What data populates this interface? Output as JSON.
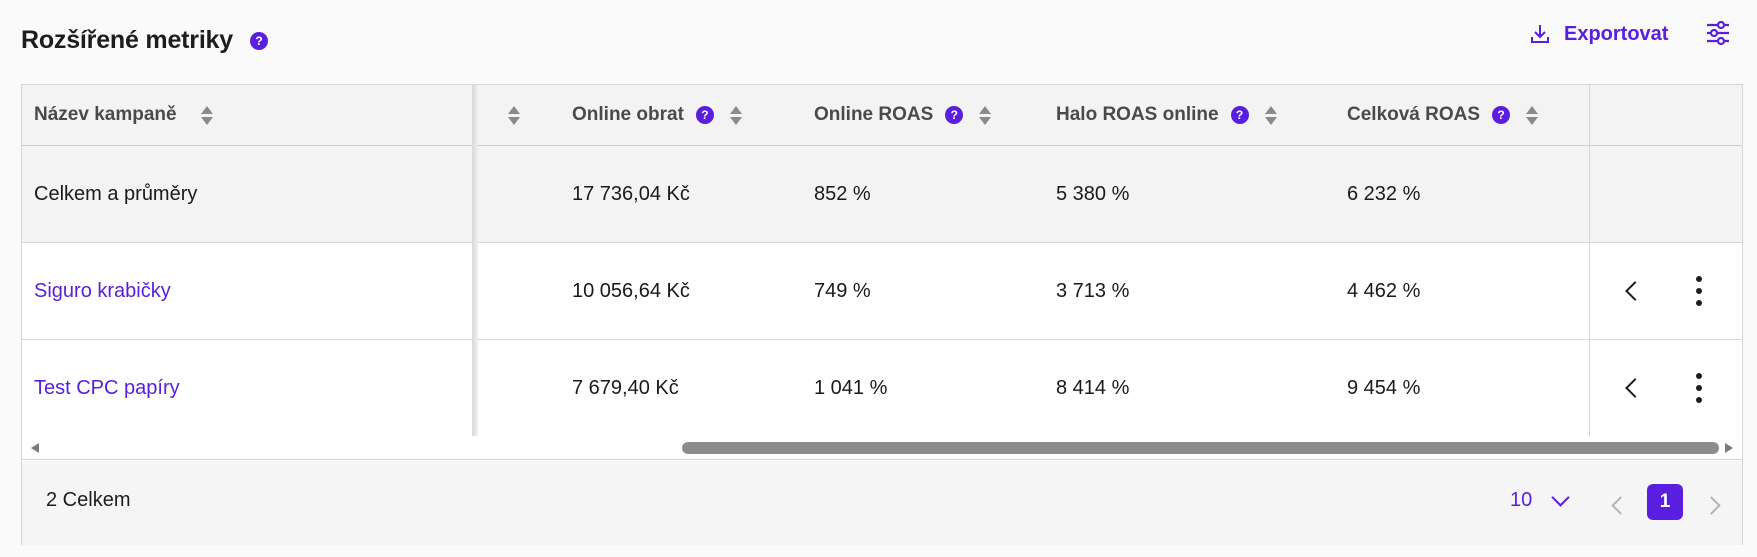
{
  "header": {
    "title": "Rozšířené metriky",
    "help_glyph": "?",
    "export_label": "Exportovat",
    "export_icon": "download-icon",
    "settings_icon": "sliders-icon"
  },
  "table": {
    "columns": [
      {
        "label": "Název kampaně",
        "help": false
      },
      {
        "label": "",
        "help": false
      },
      {
        "label": "Online obrat",
        "help": true
      },
      {
        "label": "Online ROAS",
        "help": true
      },
      {
        "label": "Halo ROAS online",
        "help": true
      },
      {
        "label": "Celková ROAS",
        "help": true
      }
    ],
    "total_row": {
      "name": "Celkem a průměry",
      "online_obrat": "17 736,04 Kč",
      "online_roas": "852 %",
      "halo_roas": "5 380 %",
      "celkova_roas": "6 232 %"
    },
    "rows": [
      {
        "name": "Siguro krabičky",
        "online_obrat": "10 056,64 Kč",
        "online_roas": "749 %",
        "halo_roas": "3 713 %",
        "celkova_roas": "4 462 %"
      },
      {
        "name": "Test CPC papíry",
        "online_obrat": "7 679,40 Kč",
        "online_roas": "1 041 %",
        "halo_roas": "8 414 %",
        "celkova_roas": "9 454 %"
      }
    ]
  },
  "footer": {
    "count_label": "2 Celkem",
    "page_size": "10",
    "current_page": "1"
  },
  "colors": {
    "accent": "#5a1ee0",
    "text": "#1d1d1d",
    "header_bg": "#f3f3f3"
  }
}
